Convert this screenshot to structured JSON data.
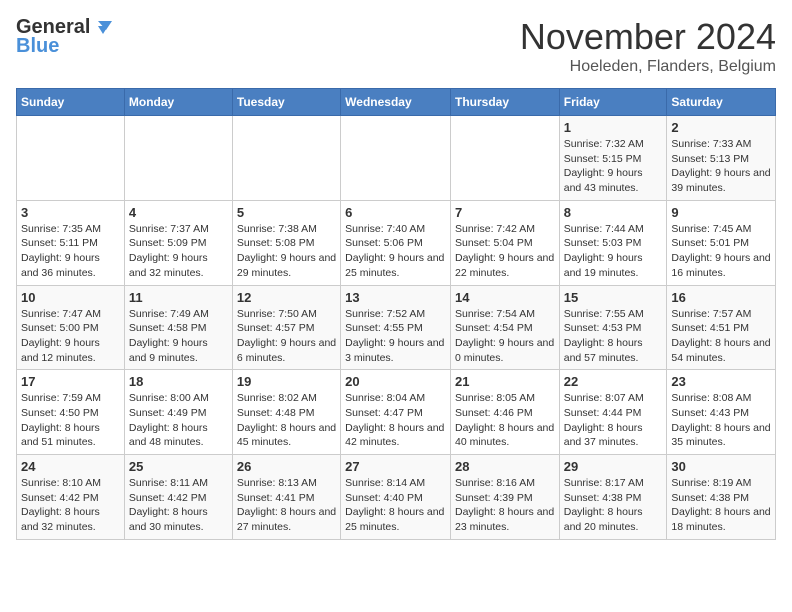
{
  "header": {
    "logo_general": "General",
    "logo_blue": "Blue",
    "month_title": "November 2024",
    "location": "Hoeleden, Flanders, Belgium"
  },
  "weekdays": [
    "Sunday",
    "Monday",
    "Tuesday",
    "Wednesday",
    "Thursday",
    "Friday",
    "Saturday"
  ],
  "weeks": [
    [
      {
        "day": "",
        "sunrise": "",
        "sunset": "",
        "daylight": "",
        "empty": true
      },
      {
        "day": "",
        "sunrise": "",
        "sunset": "",
        "daylight": "",
        "empty": true
      },
      {
        "day": "",
        "sunrise": "",
        "sunset": "",
        "daylight": "",
        "empty": true
      },
      {
        "day": "",
        "sunrise": "",
        "sunset": "",
        "daylight": "",
        "empty": true
      },
      {
        "day": "",
        "sunrise": "",
        "sunset": "",
        "daylight": "",
        "empty": true
      },
      {
        "day": "1",
        "sunrise": "Sunrise: 7:32 AM",
        "sunset": "Sunset: 5:15 PM",
        "daylight": "Daylight: 9 hours and 43 minutes."
      },
      {
        "day": "2",
        "sunrise": "Sunrise: 7:33 AM",
        "sunset": "Sunset: 5:13 PM",
        "daylight": "Daylight: 9 hours and 39 minutes."
      }
    ],
    [
      {
        "day": "3",
        "sunrise": "Sunrise: 7:35 AM",
        "sunset": "Sunset: 5:11 PM",
        "daylight": "Daylight: 9 hours and 36 minutes."
      },
      {
        "day": "4",
        "sunrise": "Sunrise: 7:37 AM",
        "sunset": "Sunset: 5:09 PM",
        "daylight": "Daylight: 9 hours and 32 minutes."
      },
      {
        "day": "5",
        "sunrise": "Sunrise: 7:38 AM",
        "sunset": "Sunset: 5:08 PM",
        "daylight": "Daylight: 9 hours and 29 minutes."
      },
      {
        "day": "6",
        "sunrise": "Sunrise: 7:40 AM",
        "sunset": "Sunset: 5:06 PM",
        "daylight": "Daylight: 9 hours and 25 minutes."
      },
      {
        "day": "7",
        "sunrise": "Sunrise: 7:42 AM",
        "sunset": "Sunset: 5:04 PM",
        "daylight": "Daylight: 9 hours and 22 minutes."
      },
      {
        "day": "8",
        "sunrise": "Sunrise: 7:44 AM",
        "sunset": "Sunset: 5:03 PM",
        "daylight": "Daylight: 9 hours and 19 minutes."
      },
      {
        "day": "9",
        "sunrise": "Sunrise: 7:45 AM",
        "sunset": "Sunset: 5:01 PM",
        "daylight": "Daylight: 9 hours and 16 minutes."
      }
    ],
    [
      {
        "day": "10",
        "sunrise": "Sunrise: 7:47 AM",
        "sunset": "Sunset: 5:00 PM",
        "daylight": "Daylight: 9 hours and 12 minutes."
      },
      {
        "day": "11",
        "sunrise": "Sunrise: 7:49 AM",
        "sunset": "Sunset: 4:58 PM",
        "daylight": "Daylight: 9 hours and 9 minutes."
      },
      {
        "day": "12",
        "sunrise": "Sunrise: 7:50 AM",
        "sunset": "Sunset: 4:57 PM",
        "daylight": "Daylight: 9 hours and 6 minutes."
      },
      {
        "day": "13",
        "sunrise": "Sunrise: 7:52 AM",
        "sunset": "Sunset: 4:55 PM",
        "daylight": "Daylight: 9 hours and 3 minutes."
      },
      {
        "day": "14",
        "sunrise": "Sunrise: 7:54 AM",
        "sunset": "Sunset: 4:54 PM",
        "daylight": "Daylight: 9 hours and 0 minutes."
      },
      {
        "day": "15",
        "sunrise": "Sunrise: 7:55 AM",
        "sunset": "Sunset: 4:53 PM",
        "daylight": "Daylight: 8 hours and 57 minutes."
      },
      {
        "day": "16",
        "sunrise": "Sunrise: 7:57 AM",
        "sunset": "Sunset: 4:51 PM",
        "daylight": "Daylight: 8 hours and 54 minutes."
      }
    ],
    [
      {
        "day": "17",
        "sunrise": "Sunrise: 7:59 AM",
        "sunset": "Sunset: 4:50 PM",
        "daylight": "Daylight: 8 hours and 51 minutes."
      },
      {
        "day": "18",
        "sunrise": "Sunrise: 8:00 AM",
        "sunset": "Sunset: 4:49 PM",
        "daylight": "Daylight: 8 hours and 48 minutes."
      },
      {
        "day": "19",
        "sunrise": "Sunrise: 8:02 AM",
        "sunset": "Sunset: 4:48 PM",
        "daylight": "Daylight: 8 hours and 45 minutes."
      },
      {
        "day": "20",
        "sunrise": "Sunrise: 8:04 AM",
        "sunset": "Sunset: 4:47 PM",
        "daylight": "Daylight: 8 hours and 42 minutes."
      },
      {
        "day": "21",
        "sunrise": "Sunrise: 8:05 AM",
        "sunset": "Sunset: 4:46 PM",
        "daylight": "Daylight: 8 hours and 40 minutes."
      },
      {
        "day": "22",
        "sunrise": "Sunrise: 8:07 AM",
        "sunset": "Sunset: 4:44 PM",
        "daylight": "Daylight: 8 hours and 37 minutes."
      },
      {
        "day": "23",
        "sunrise": "Sunrise: 8:08 AM",
        "sunset": "Sunset: 4:43 PM",
        "daylight": "Daylight: 8 hours and 35 minutes."
      }
    ],
    [
      {
        "day": "24",
        "sunrise": "Sunrise: 8:10 AM",
        "sunset": "Sunset: 4:42 PM",
        "daylight": "Daylight: 8 hours and 32 minutes."
      },
      {
        "day": "25",
        "sunrise": "Sunrise: 8:11 AM",
        "sunset": "Sunset: 4:42 PM",
        "daylight": "Daylight: 8 hours and 30 minutes."
      },
      {
        "day": "26",
        "sunrise": "Sunrise: 8:13 AM",
        "sunset": "Sunset: 4:41 PM",
        "daylight": "Daylight: 8 hours and 27 minutes."
      },
      {
        "day": "27",
        "sunrise": "Sunrise: 8:14 AM",
        "sunset": "Sunset: 4:40 PM",
        "daylight": "Daylight: 8 hours and 25 minutes."
      },
      {
        "day": "28",
        "sunrise": "Sunrise: 8:16 AM",
        "sunset": "Sunset: 4:39 PM",
        "daylight": "Daylight: 8 hours and 23 minutes."
      },
      {
        "day": "29",
        "sunrise": "Sunrise: 8:17 AM",
        "sunset": "Sunset: 4:38 PM",
        "daylight": "Daylight: 8 hours and 20 minutes."
      },
      {
        "day": "30",
        "sunrise": "Sunrise: 8:19 AM",
        "sunset": "Sunset: 4:38 PM",
        "daylight": "Daylight: 8 hours and 18 minutes."
      }
    ]
  ]
}
